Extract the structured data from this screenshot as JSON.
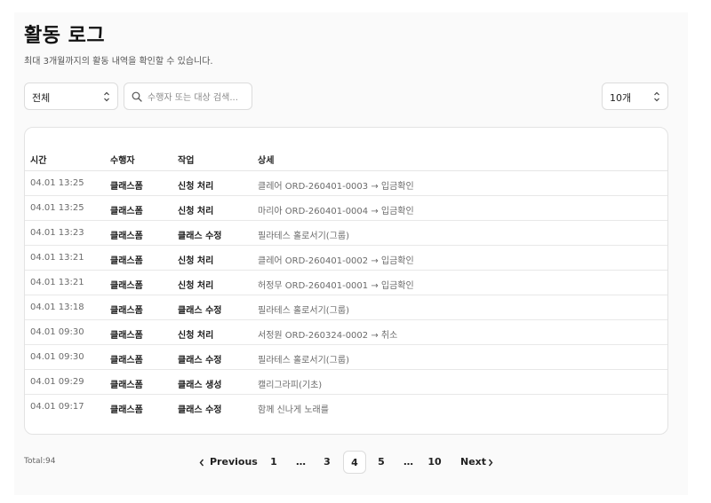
{
  "header": {
    "title": "활동 로그",
    "subtitle": "최대 3개월까지의 활동 내역을 확인할 수 있습니다."
  },
  "filters": {
    "scope_select": {
      "value": "전체",
      "icon": "chevron-up-down-icon"
    },
    "search": {
      "placeholder": "수행자 또는 대상 검색...",
      "value": "",
      "icon": "search-icon"
    },
    "page_size_select": {
      "value": "10개",
      "icon": "chevron-up-down-icon"
    }
  },
  "table": {
    "columns": [
      "시간",
      "수행자",
      "작업",
      "상세"
    ],
    "rows": [
      {
        "time": "04.01 13:25",
        "actor": "클래스폼",
        "action": "신청 처리",
        "detail": "클레어 ORD-260401-0003 → 입금확인"
      },
      {
        "time": "04.01 13:25",
        "actor": "클래스폼",
        "action": "신청 처리",
        "detail": "마리아 ORD-260401-0004 → 입금확인"
      },
      {
        "time": "04.01 13:23",
        "actor": "클래스폼",
        "action": "클래스 수정",
        "detail": "필라테스 홀로서기(그룹)"
      },
      {
        "time": "04.01 13:21",
        "actor": "클래스폼",
        "action": "신청 처리",
        "detail": "클레어 ORD-260401-0002 → 입금확인"
      },
      {
        "time": "04.01 13:21",
        "actor": "클래스폼",
        "action": "신청 처리",
        "detail": "허정무 ORD-260401-0001 → 입금확인"
      },
      {
        "time": "04.01 13:18",
        "actor": "클래스폼",
        "action": "클래스 수정",
        "detail": "필라테스 홀로서기(그룹)"
      },
      {
        "time": "04.01 09:30",
        "actor": "클래스폼",
        "action": "신청 처리",
        "detail": "서정원 ORD-260324-0002 → 취소"
      },
      {
        "time": "04.01 09:30",
        "actor": "클래스폼",
        "action": "클래스 수정",
        "detail": "필라테스 홀로서기(그룹)"
      },
      {
        "time": "04.01 09:29",
        "actor": "클래스폼",
        "action": "클래스 생성",
        "detail": "캘리그라피(기초)"
      },
      {
        "time": "04.01 09:17",
        "actor": "클래스폼",
        "action": "클래스 수정",
        "detail": "함께 신나게 노래를"
      }
    ]
  },
  "footer": {
    "total": "Total:94",
    "pagination": {
      "previous": "Previous",
      "next": "Next",
      "items": [
        "1",
        "…",
        "3",
        "4",
        "5",
        "…",
        "10"
      ],
      "current": "4",
      "chevron_left_icon": "chevron-left-icon",
      "chevron_right_icon": "chevron-right-icon"
    }
  }
}
